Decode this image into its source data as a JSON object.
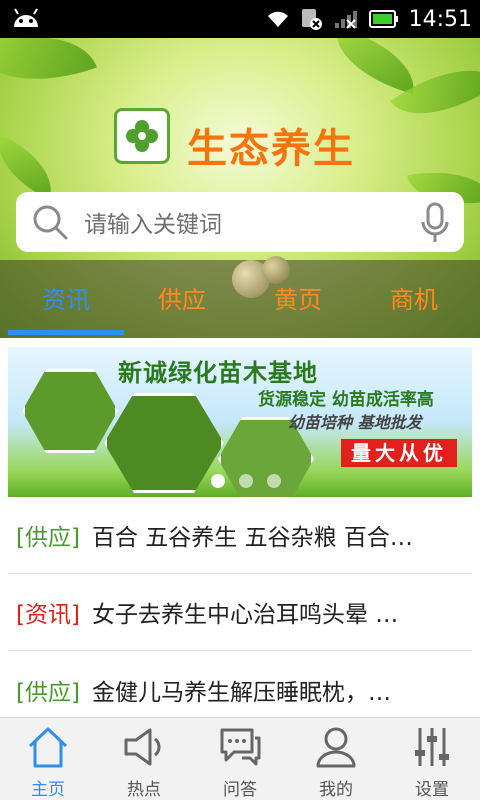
{
  "status_bar": {
    "time": "14:51"
  },
  "header": {
    "title": "生态养生",
    "search": {
      "placeholder": "请输入关键词"
    },
    "tabs": [
      {
        "label": "资讯",
        "active": true
      },
      {
        "label": "供应",
        "active": false
      },
      {
        "label": "黄页",
        "active": false
      },
      {
        "label": "商机",
        "active": false
      }
    ]
  },
  "banner": {
    "title": "新诚绿化苗木基地",
    "subtitle": "货源稳定 幼苗成活率高",
    "tagline": "幼苗培种  基地批发",
    "badge": "量大从优",
    "slides_count": 3,
    "active_slide": 1
  },
  "news": [
    {
      "category": "[供应]",
      "category_color": "#4a9a2e",
      "text": "百合 五谷养生 五谷杂粮 百合…"
    },
    {
      "category": "[资讯]",
      "category_color": "#e0201a",
      "text": "女子去养生中心治耳鸣头晕 …"
    },
    {
      "category": "[供应]",
      "category_color": "#4a9a2e",
      "text": "金健儿马养生解压睡眠枕，…"
    }
  ],
  "bottom_nav": [
    {
      "label": "主页",
      "icon": "home-icon",
      "active": true
    },
    {
      "label": "热点",
      "icon": "megaphone-icon",
      "active": false
    },
    {
      "label": "问答",
      "icon": "chat-icon",
      "active": false
    },
    {
      "label": "我的",
      "icon": "user-icon",
      "active": false
    },
    {
      "label": "设置",
      "icon": "sliders-icon",
      "active": false
    }
  ],
  "colors": {
    "accent": "#2d8ff0",
    "title_orange": "#f5740e",
    "tab_orange": "#ff8a1f"
  }
}
